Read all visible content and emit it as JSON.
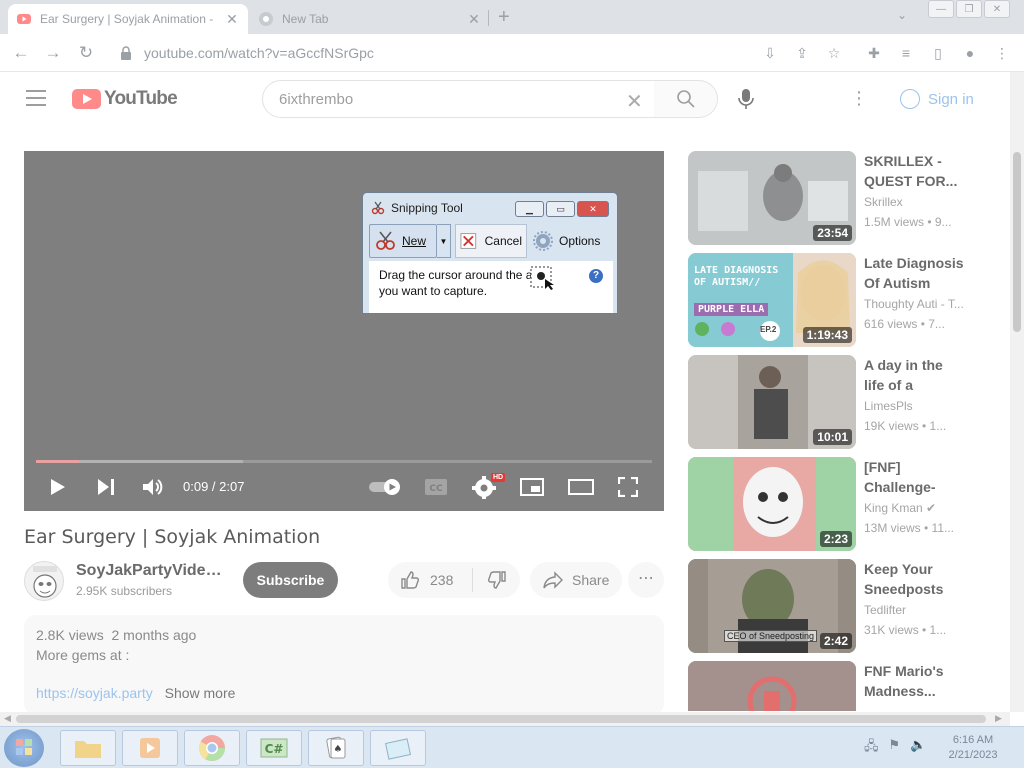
{
  "browser": {
    "tabs": [
      {
        "title": "Ear Surgery | Soyjak Animation -",
        "active": true
      },
      {
        "title": "New Tab",
        "active": false
      }
    ],
    "url": "youtube.com/watch?v=aGccfNSrGpc"
  },
  "youtube": {
    "logo_text": "YouTube",
    "search_value": "6ixthrembo",
    "sign_in": "Sign in"
  },
  "player": {
    "time": "0:09 / 2:07",
    "played_fraction": 0.07,
    "hd_badge": "HD"
  },
  "snipping_tool": {
    "title": "Snipping Tool",
    "new_label": "New",
    "cancel_label": "Cancel",
    "options_label": "Options",
    "message_line1": "Drag the cursor around the a",
    "message_line2": "you want to capture."
  },
  "video": {
    "title": "Ear Surgery | Soyjak Animation",
    "channel": "SoyJakPartyVideo...",
    "subscribers": "2.95K subscribers",
    "subscribe": "Subscribe",
    "likes": "238",
    "share": "Share",
    "views": "2.8K views",
    "age": "2 months ago",
    "desc_line": "More gems at :",
    "link": "https://soyjak.party",
    "show_more": "Show more"
  },
  "recommendations": [
    {
      "title": "SKRILLEX - QUEST FOR...",
      "channel": "Skrillex",
      "meta": "1.5M views  •  9...",
      "duration": "23:54"
    },
    {
      "title": "Late Diagnosis Of Autism Wit...",
      "channel": "Thoughty Auti - T...",
      "meta": "616 views  •  7...",
      "duration": "1:19:43",
      "thumb_text_1": "LATE DIAGNOSIS OF AUTISM//",
      "thumb_text_2": "PURPLE ELLA",
      "thumb_text_3": "EP.2"
    },
    {
      "title": "A day in the life of a THEATRE...",
      "channel": "LimesPls",
      "meta": "19K views  •  1...",
      "duration": "10:01"
    },
    {
      "title": "[FNF] Challenge-ED...",
      "channel": "King Kman",
      "meta": "13M views  •  11...",
      "duration": "2:23"
    },
    {
      "title": "Keep Your Sneedposts B...",
      "channel": "Tedlifter",
      "meta": "31K views  •  1...",
      "duration": "2:42",
      "thumb_text_1": "CEO of Sneedposting"
    },
    {
      "title": "FNF Mario's Madness...",
      "channel": "",
      "meta": "",
      "duration": ""
    }
  ],
  "taskbar": {
    "time": "6:16 AM",
    "date": "2/21/2023"
  },
  "colors": {
    "yt_red_faded": "#ff8a8a",
    "link_blue_faded": "#9cc3ee",
    "player_bg": "#7f7f7f"
  }
}
